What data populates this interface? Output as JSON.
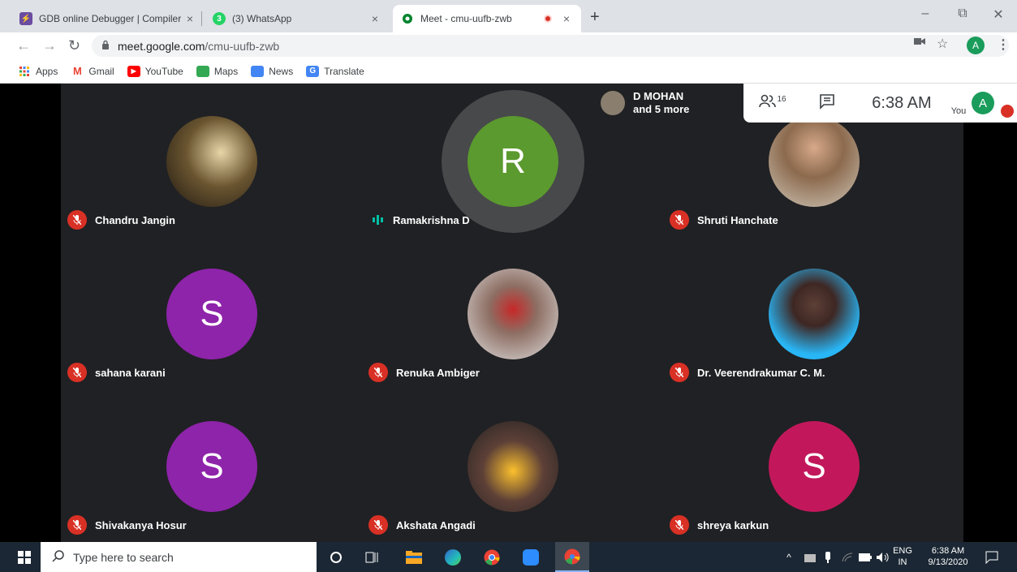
{
  "tabs": [
    {
      "title": "GDB online Debugger | Compiler",
      "close": "×"
    },
    {
      "title": "(3) WhatsApp",
      "close": "×"
    },
    {
      "title": "Meet - cmu-uufb-zwb",
      "close": "×"
    }
  ],
  "window": {
    "minimize": "–",
    "maximize": "⧉",
    "close": "✕",
    "newtab": "+"
  },
  "toolbar": {
    "url_domain": "meet.google.com",
    "url_path": "/cmu-uufb-zwb",
    "profile": "A"
  },
  "bookmarks": [
    {
      "label": "Apps"
    },
    {
      "label": "Gmail"
    },
    {
      "label": "YouTube"
    },
    {
      "label": "Maps"
    },
    {
      "label": "News"
    },
    {
      "label": "Translate"
    }
  ],
  "meet": {
    "presenter_name": "D MOHAN",
    "presenter_more": "and 5 more",
    "participant_count": "16",
    "clock": "6:38 AM",
    "you_label": "You",
    "you_initial": "A",
    "participants": [
      {
        "name": "Chandru Jangin"
      },
      {
        "name": "Ramakrishna D",
        "initial": "R"
      },
      {
        "name": "Shruti Hanchate"
      },
      {
        "name": "sahana karani",
        "initial": "S"
      },
      {
        "name": "Renuka Ambiger"
      },
      {
        "name": "Dr. Veerendrakumar C. M."
      },
      {
        "name": "Shivakanya Hosur",
        "initial": "S"
      },
      {
        "name": "Akshata Angadi"
      },
      {
        "name": "shreya karkun",
        "initial": "S"
      }
    ]
  },
  "taskbar": {
    "search_placeholder": "Type here to search",
    "lang": "ENG",
    "region": "IN",
    "time": "6:38 AM",
    "date": "9/13/2020"
  },
  "colors": {
    "purple": "#8e24aa",
    "green": "#5b9a2e",
    "crimson": "#c2185b",
    "mute": "#d93025"
  }
}
